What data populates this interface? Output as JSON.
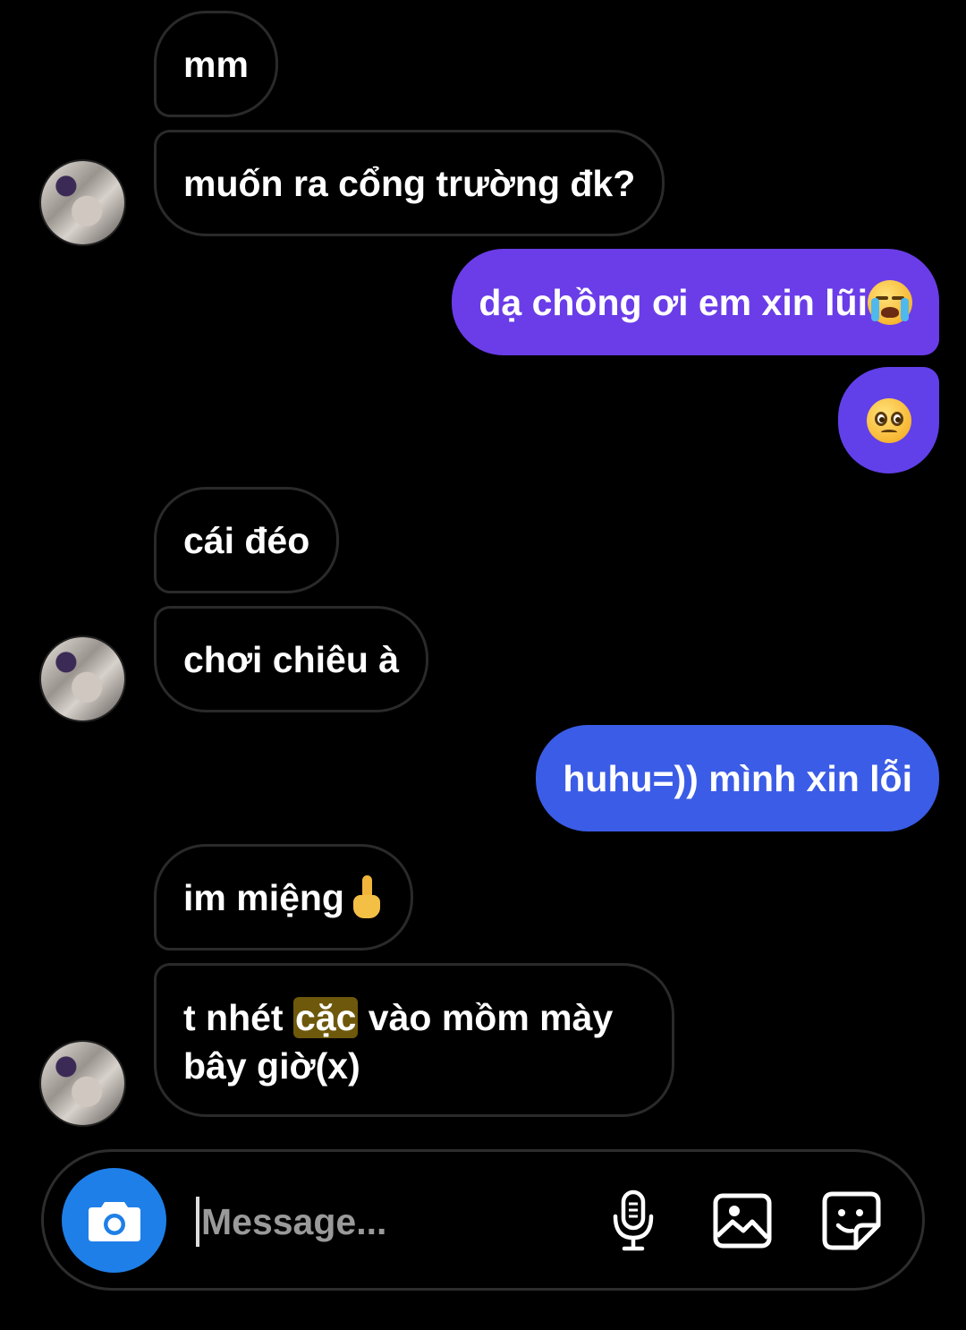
{
  "messages": [
    {
      "id": "b1",
      "direction": "in",
      "text": "mm"
    },
    {
      "id": "b2",
      "direction": "in",
      "text": "muốn ra cổng trường đk?"
    },
    {
      "id": "b3",
      "direction": "out",
      "text": "dạ chồng ơi em xin lũi",
      "emoji": "loudly-crying-face-emoji"
    },
    {
      "id": "b4",
      "direction": "out",
      "text": "",
      "emoji": "pleading-face-emoji"
    },
    {
      "id": "b5",
      "direction": "in",
      "text": "cái đéo"
    },
    {
      "id": "b6",
      "direction": "in",
      "text": "chơi chiêu à"
    },
    {
      "id": "b7",
      "direction": "out",
      "text": "huhu=)) mình xin lỗi"
    },
    {
      "id": "b8",
      "direction": "in",
      "text": "im miệng",
      "emoji": "middle-finger-emoji"
    },
    {
      "id": "b9",
      "direction": "in",
      "text_before": "t nhét ",
      "text_highlight": "cặc",
      "text_after": " vào mồm mày bây giờ(x)"
    }
  ],
  "composer": {
    "placeholder": "Message...",
    "value": "",
    "icons": [
      "camera-icon",
      "microphone-icon",
      "gallery-icon",
      "sticker-icon"
    ]
  },
  "colors": {
    "background": "#000000",
    "incoming_border": "#2a2a2a",
    "outgoing_top": "#6a3de8",
    "outgoing_bottom": "#3b5ce6",
    "camera_button": "#1f7fe8",
    "highlight": "#c8a014"
  }
}
